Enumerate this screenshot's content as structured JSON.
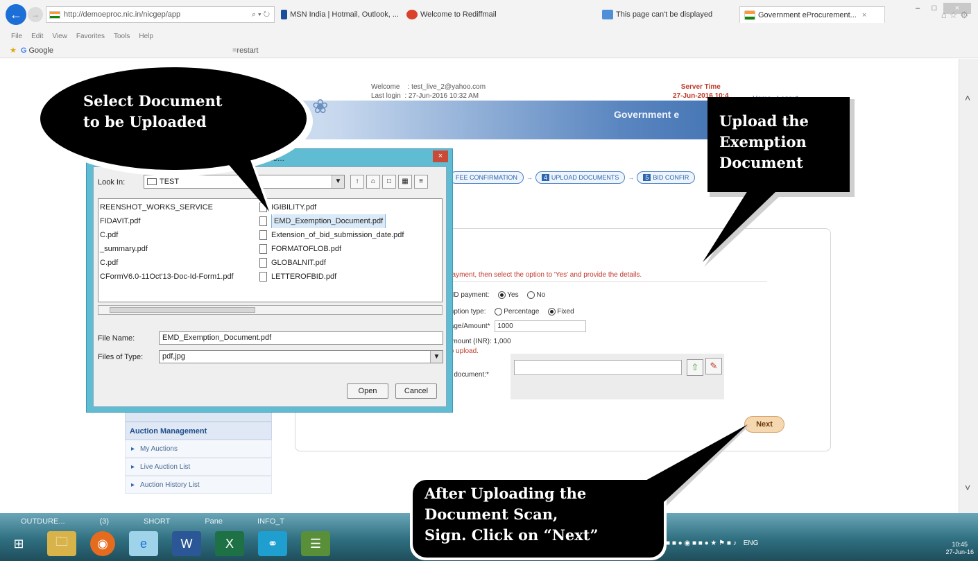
{
  "browser": {
    "url": "http://demoeproc.nic.in/nicgep/app",
    "address_tools": "⌕ ▾ ↻",
    "tabs": [
      {
        "label": "MSN India | Hotmail, Outlook, ...",
        "color": "#1b4e9b"
      },
      {
        "label": "Welcome to Rediffmail",
        "color": "#d9412b"
      },
      {
        "label": "This page can't be displayed",
        "color": "#4f8fd8"
      },
      {
        "label": "Government eProcurement...",
        "color": "#ff9933"
      }
    ],
    "menu": [
      "File",
      "Edit",
      "View",
      "Favorites",
      "Tools",
      "Help"
    ],
    "favorites": {
      "google": "Google",
      "restart": "=restart"
    }
  },
  "site": {
    "welcome_label": "Welcome",
    "welcome_value": ": test_live_2@yahoo.com",
    "lastlogin_label": "Last login",
    "lastlogin_value": ": 27-Jun-2016 10:32 AM",
    "server_time_label": "Server Time",
    "server_time_value": "27-Jun-2016 10:4",
    "home": "Home",
    "logout": "Logout",
    "title": "Government e"
  },
  "steps": [
    {
      "num": "",
      "label": "FEE CONFIRMATION"
    },
    {
      "num": "4",
      "label": "UPLOAD DOCUMENTS"
    },
    {
      "num": "5",
      "label": "BID CONFIR"
    }
  ],
  "form": {
    "note": "payment, then select the option to 'Yes' and provide the details.",
    "emd_label": "MD payment:",
    "emd_yes": "Yes",
    "emd_no": "No",
    "type_label": "mption type:",
    "type_pct": "Percentage",
    "type_fixed": "Fixed",
    "amount_label": "tage/Amount*",
    "amount_value": "1000",
    "inr_label": "amount (INR):",
    "inr_value": "1,000",
    "upload_note": "to upload.",
    "doc_label": "n document:*",
    "next": "Next"
  },
  "side_menu": {
    "heading": "Auction Management",
    "items": [
      "My Auctions",
      "Live Auction List",
      "Auction History List"
    ]
  },
  "dialog": {
    "title": "Browse...",
    "close": "×",
    "lookin_label": "Look In:",
    "lookin_value": "TEST",
    "files_col1": [
      "REENSHOT_WORKS_SERVICE",
      "FIDAVIT.pdf",
      "C.pdf",
      "_summary.pdf",
      "C.pdf",
      "CFormV6.0-11Oct'13-Doc-Id-Form1.pdf"
    ],
    "files_col2": [
      "IGIBILITY.pdf",
      "EMD_Exemption_Document.pdf",
      "Extension_of_bid_submission_date.pdf",
      "FORMATOFLOB.pdf",
      "GLOBALNIT.pdf",
      "LETTEROFBID.pdf"
    ],
    "filename_label": "File Name:",
    "filename_value": "EMD_Exemption_Document.pdf",
    "filetype_label": "Files of Type:",
    "filetype_value": "pdf,jpg",
    "open": "Open",
    "cancel": "Cancel"
  },
  "taskbar": {
    "labels": [
      "OUTDURE...",
      "(3)",
      "SHORT",
      "Pane",
      "INFO_T"
    ],
    "lang": "ENG",
    "time": "10:45",
    "date": "27-Jun-16"
  },
  "callouts": {
    "select_line1": "Select Document",
    "select_line2": "to be Uploaded",
    "upload_line1": "Upload the",
    "upload_line2": "Exemption",
    "upload_line3": "Document",
    "after_line1": "After Uploading the",
    "after_line2": "Document Scan,",
    "after_line3": "Sign. Click on “Next”"
  }
}
